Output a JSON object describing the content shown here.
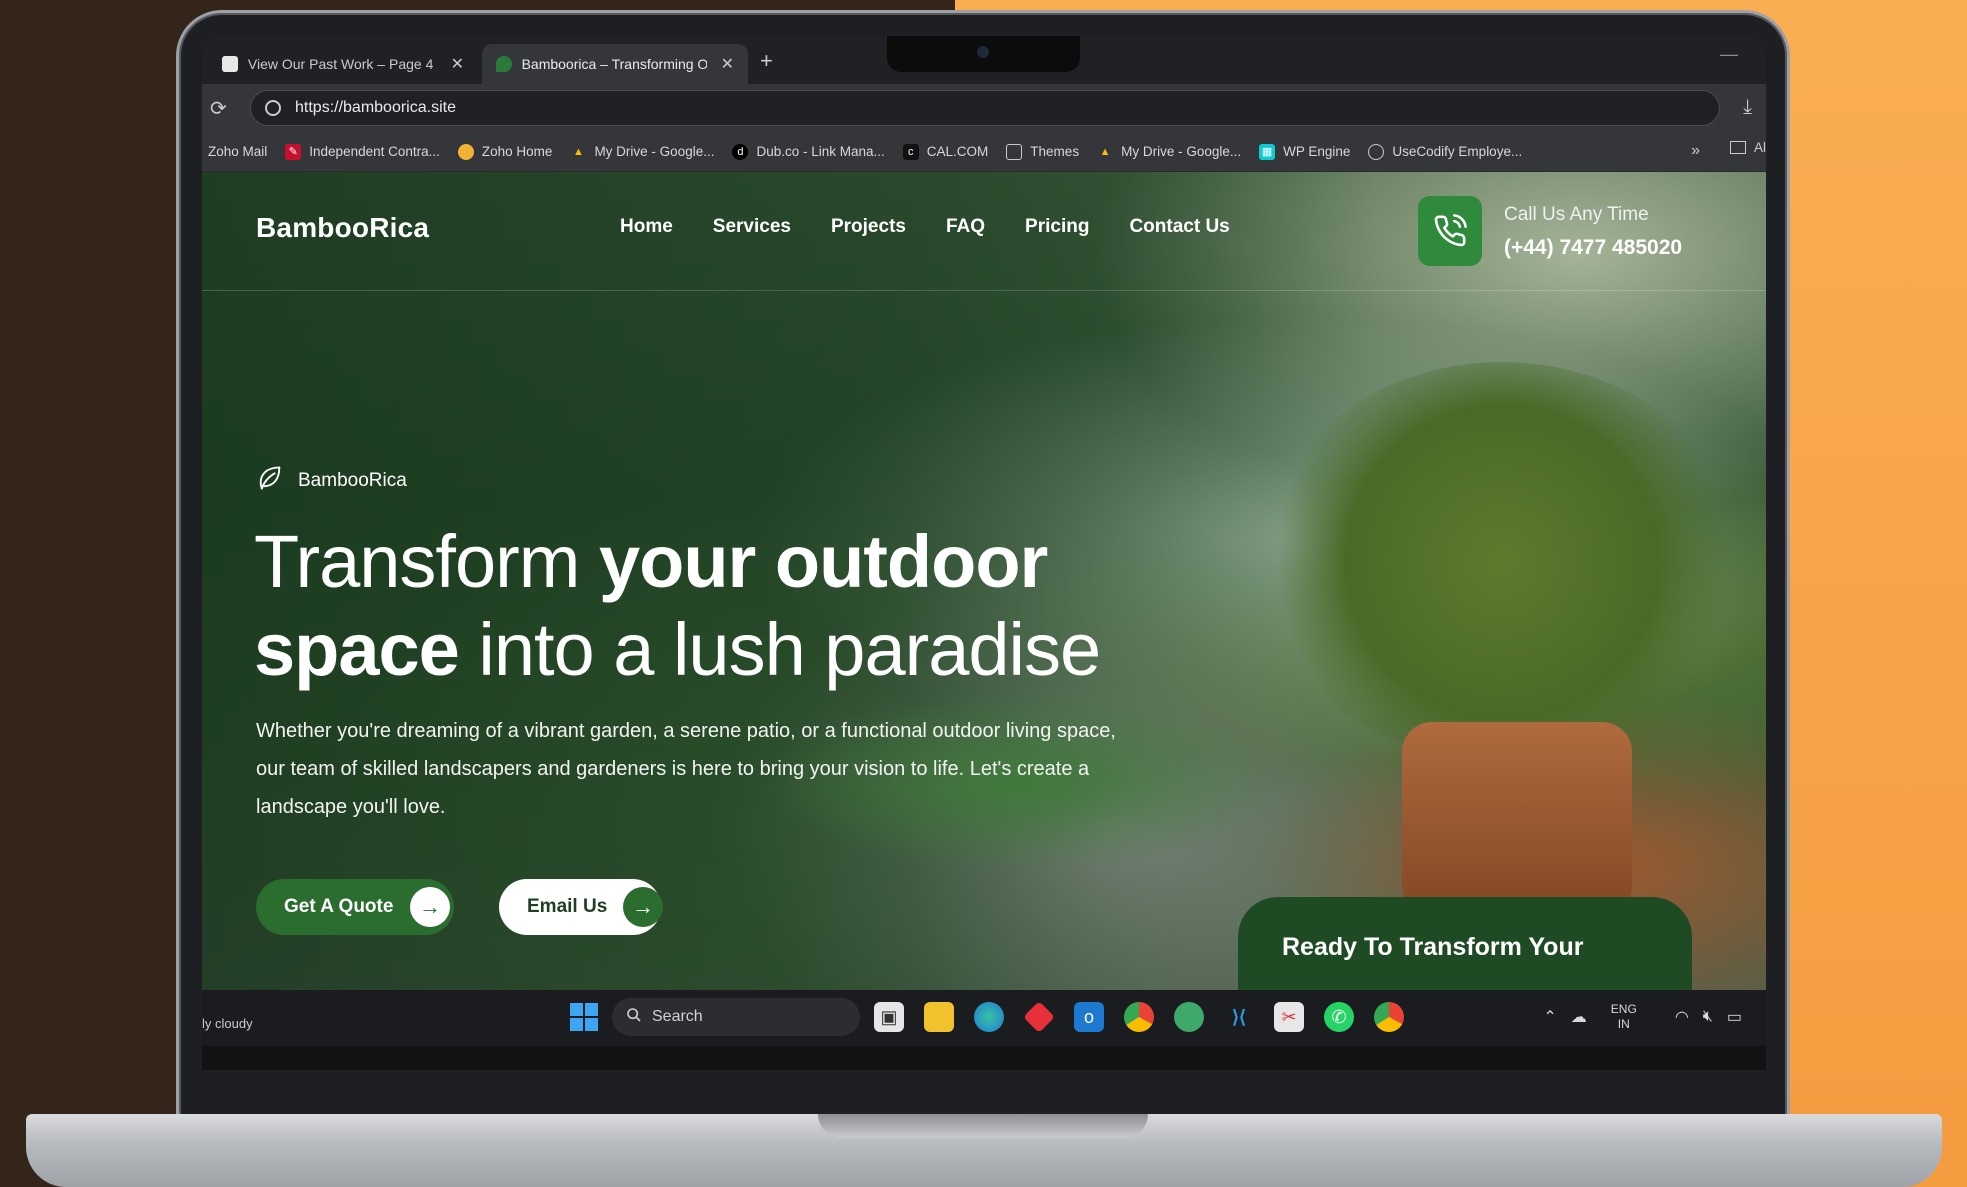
{
  "browser": {
    "tabs": [
      {
        "title": "View Our Past Work – Page 4 –",
        "active": false
      },
      {
        "title": "Bamboorica – Transforming Ou",
        "active": true
      }
    ],
    "url": "https://bamboorica.site",
    "bookmarks": [
      {
        "label": "Zoho Mail",
        "icon": "zoho-icon",
        "color": "#d33a2c"
      },
      {
        "label": "Independent Contra...",
        "icon": "contract-icon",
        "color": "#c8102e"
      },
      {
        "label": "Zoho Home",
        "icon": "zoho-home-icon",
        "color": "#f2b134"
      },
      {
        "label": "My Drive - Google...",
        "icon": "google-drive-icon",
        "color": "#34a853"
      },
      {
        "label": "Dub.co - Link Mana...",
        "icon": "dub-icon",
        "color": "#000000"
      },
      {
        "label": "CAL.COM",
        "icon": "cal-icon",
        "color": "#111111"
      },
      {
        "label": "Themes",
        "icon": "folder-icon",
        "color": "#c9cbce"
      },
      {
        "label": "My Drive - Google...",
        "icon": "google-drive-icon",
        "color": "#34a853"
      },
      {
        "label": "WP Engine",
        "icon": "wp-engine-icon",
        "color": "#0ecad4"
      },
      {
        "label": "UseCodify Employe...",
        "icon": "globe-icon",
        "color": "#c9cbce"
      }
    ],
    "bookmark_overflow": "»",
    "bookmark_folder_cut": "Al"
  },
  "site": {
    "logo": "BambooRica",
    "nav": [
      "Home",
      "Services",
      "Projects",
      "FAQ",
      "Pricing",
      "Contact Us"
    ],
    "call_label": "Call Us Any Time",
    "call_number": "(+44) 7477 485020",
    "eyebrow": "BambooRica",
    "hero_line1_light": "Transform ",
    "hero_line1_bold": "your outdoor",
    "hero_line2_bold": "space",
    "hero_line2_light": " into a lush paradise",
    "hero_desc": "Whether you're dreaming of a vibrant garden, a serene patio, or a functional outdoor living space, our team of skilled landscapers and gardeners is here to bring your vision to life. Let's create a landscape you'll love.",
    "btn_quote": "Get A Quote",
    "btn_email": "Email Us",
    "cta_title": "Ready To Transform Your",
    "brand_green": "#2b6d2e"
  },
  "taskbar": {
    "weather": "ly cloudy",
    "search_placeholder": "Search",
    "lang_top": "ENG",
    "lang_bottom": "IN",
    "apps": [
      "task-view-icon",
      "file-explorer-icon",
      "edge-icon",
      "app-red-icon",
      "outlook-icon",
      "chrome-icon",
      "app-green-icon",
      "vscode-icon",
      "snip-icon",
      "whatsapp-icon",
      "chrome-alt-icon"
    ]
  }
}
